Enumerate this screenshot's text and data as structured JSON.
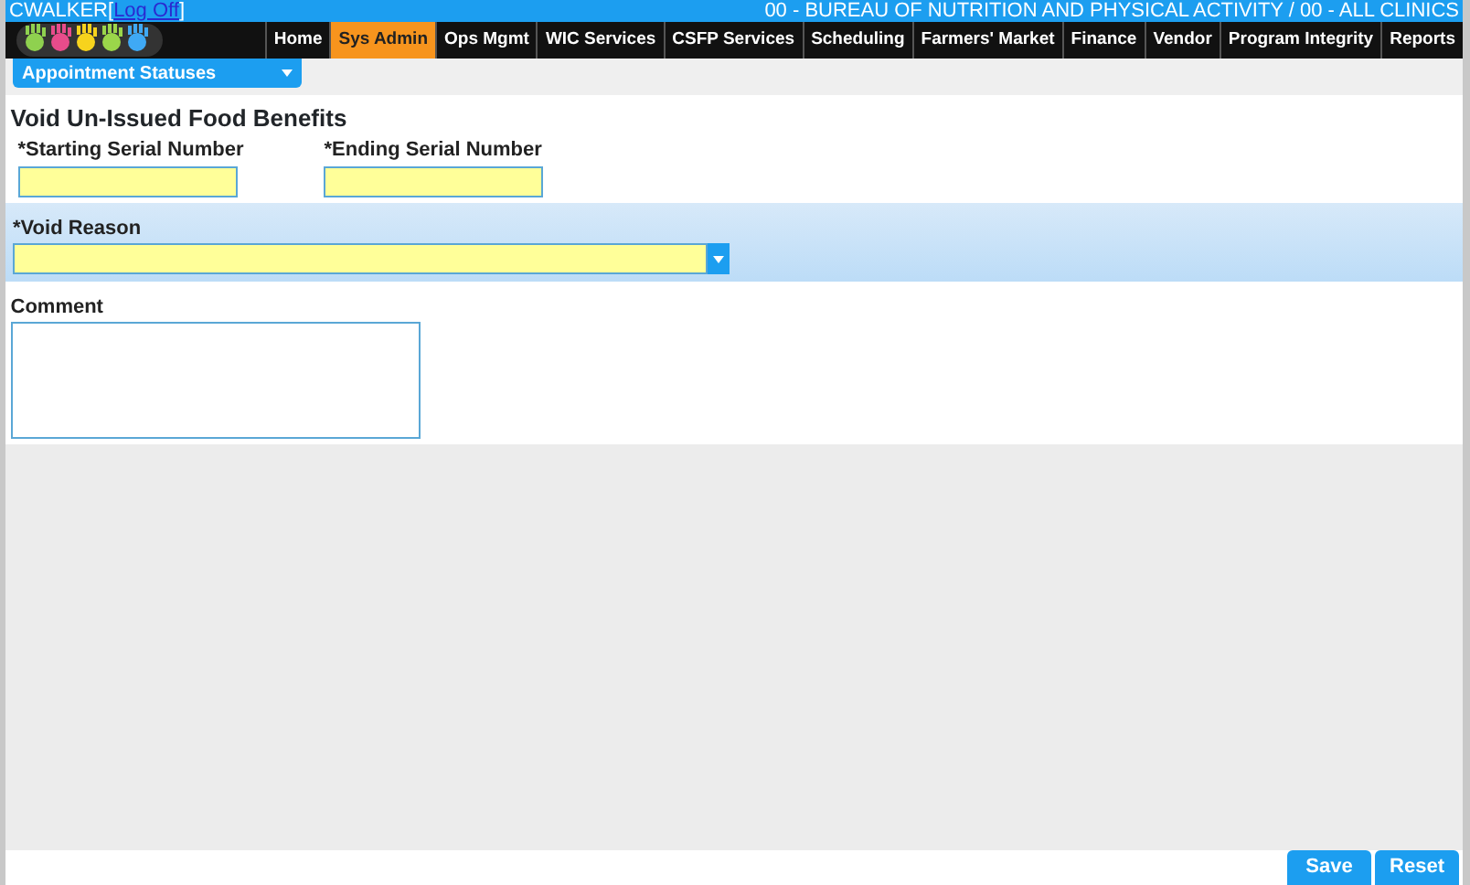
{
  "user_bar": {
    "user": "CWALKER",
    "open_bracket": "[",
    "logoff_link": "Log Off",
    "close_bracket": "]",
    "agency": "00 - BUREAU OF NUTRITION AND PHYSICAL ACTIVITY / 00 - ALL CLINICS"
  },
  "menu": [
    {
      "label": "Home",
      "selected": false
    },
    {
      "label": "Sys Admin",
      "selected": true
    },
    {
      "label": "Ops Mgmt",
      "selected": false
    },
    {
      "label": "WIC Services",
      "selected": false
    },
    {
      "label": "CSFP Services",
      "selected": false
    },
    {
      "label": "Scheduling",
      "selected": false
    },
    {
      "label": "Farmers' Market",
      "selected": false
    },
    {
      "label": "Finance",
      "selected": false
    },
    {
      "label": "Vendor",
      "selected": false
    },
    {
      "label": "Program Integrity",
      "selected": false
    },
    {
      "label": "Reports",
      "selected": false
    }
  ],
  "submenu": {
    "label": "Appointment Statuses"
  },
  "form": {
    "title": "Void Un-Issued Food Benefits",
    "starting_serial": {
      "label": "*Starting Serial Number"
    },
    "ending_serial": {
      "label": "*Ending Serial Number"
    },
    "void_reason": {
      "label": "*Void Reason"
    },
    "comment": {
      "label": "Comment"
    }
  },
  "buttons": [
    "Save",
    "Reset"
  ]
}
